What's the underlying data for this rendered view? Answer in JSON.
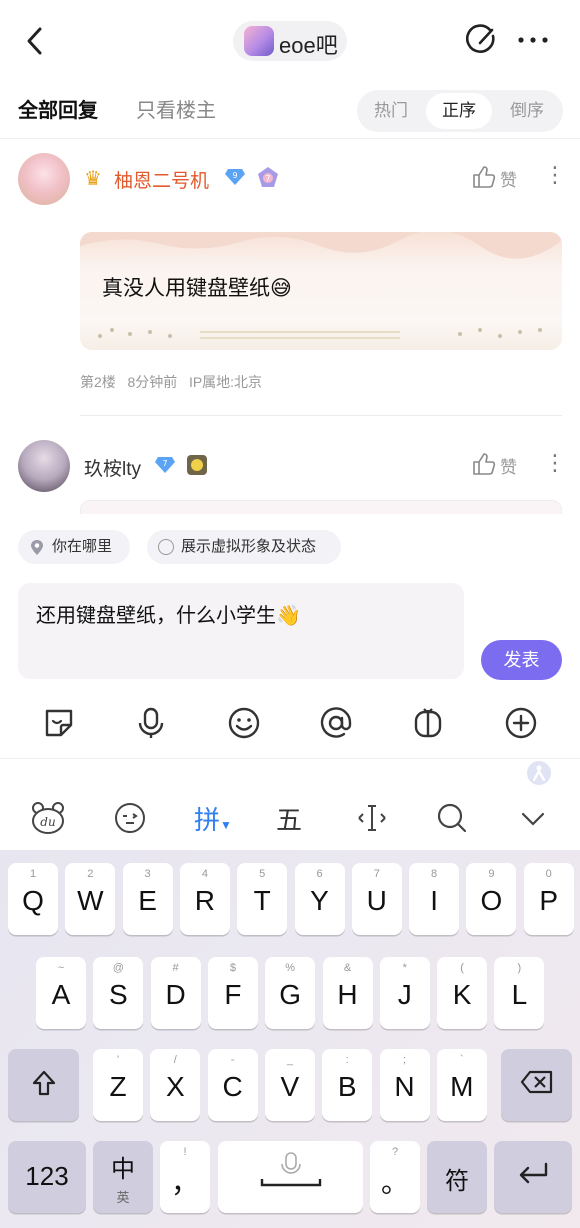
{
  "header": {
    "forum_name": "eoe吧"
  },
  "tabs": {
    "all_replies": "全部回复",
    "op_only": "只看楼主",
    "sort": {
      "hot": "热门",
      "asc": "正序",
      "desc": "倒序",
      "active": "正序"
    }
  },
  "posts": [
    {
      "username": "柚恩二号机",
      "level": "9",
      "badge_level": "7",
      "like_label": "赞",
      "content": "真没人用键盘壁纸😅",
      "floor": "第2楼",
      "time": "8分钟前",
      "ip": "IP属地:北京"
    },
    {
      "username": "玖桉lty",
      "level": "7",
      "like_label": "赞"
    }
  ],
  "composer": {
    "location_chip": "你在哪里",
    "avatar_chip": "展示虚拟形象及状态",
    "input_value": "还用键盘壁纸，什么小学生👋",
    "send_label": "发表",
    "tools": [
      "emoji-sticker-icon",
      "microphone-icon",
      "smiley-icon",
      "at-icon",
      "gift-icon",
      "plus-icon"
    ]
  },
  "keyboard": {
    "toolbar": {
      "pinyin": "拼",
      "wubi": "五"
    },
    "row1": [
      {
        "k": "Q",
        "s": "1"
      },
      {
        "k": "W",
        "s": "2"
      },
      {
        "k": "E",
        "s": "3"
      },
      {
        "k": "R",
        "s": "4"
      },
      {
        "k": "T",
        "s": "5"
      },
      {
        "k": "Y",
        "s": "6"
      },
      {
        "k": "U",
        "s": "7"
      },
      {
        "k": "I",
        "s": "8"
      },
      {
        "k": "O",
        "s": "9"
      },
      {
        "k": "P",
        "s": "0"
      }
    ],
    "row2": [
      {
        "k": "A",
        "s": "~"
      },
      {
        "k": "S",
        "s": "@"
      },
      {
        "k": "D",
        "s": "#"
      },
      {
        "k": "F",
        "s": "$"
      },
      {
        "k": "G",
        "s": "%"
      },
      {
        "k": "H",
        "s": "&"
      },
      {
        "k": "J",
        "s": "*"
      },
      {
        "k": "K",
        "s": "("
      },
      {
        "k": "L",
        "s": ")"
      }
    ],
    "row3": [
      {
        "k": "Z",
        "s": "'"
      },
      {
        "k": "X",
        "s": "/"
      },
      {
        "k": "C",
        "s": "-"
      },
      {
        "k": "V",
        "s": "_"
      },
      {
        "k": "B",
        "s": ":"
      },
      {
        "k": "N",
        "s": ";"
      },
      {
        "k": "M",
        "s": "`"
      }
    ],
    "num_key": "123",
    "lang_key_main": "中",
    "lang_key_sub": "英",
    "comma_key": "，",
    "comma_sub": "!",
    "period_key": "。",
    "period_sub": "?",
    "symbol_key": "符"
  }
}
